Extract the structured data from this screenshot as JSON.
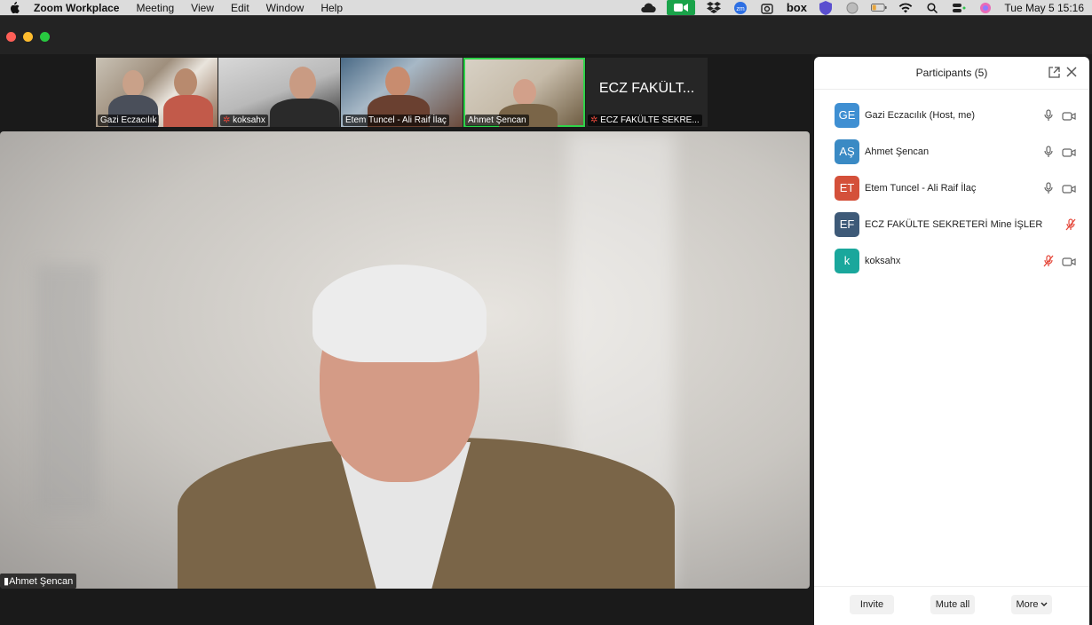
{
  "menubar": {
    "app_name": "Zoom Workplace",
    "menus": [
      "Meeting",
      "View",
      "Edit",
      "Window",
      "Help"
    ],
    "box_label": "box",
    "clock": "Tue May 5  15:16"
  },
  "thumbnails": [
    {
      "name": "Gazi Eczacılık",
      "muted": false
    },
    {
      "name": "koksahx",
      "muted": true
    },
    {
      "name": "Etem Tuncel - Ali Raif İlaç",
      "muted": false
    },
    {
      "name": "Ahmet Şencan",
      "muted": false,
      "active": true
    },
    {
      "name": "ECZ FAKÜLTE SEKRE...",
      "muted": true,
      "big_text": "ECZ FAKÜLT..."
    }
  ],
  "main_video": {
    "speaker_name": "Ahmet Şencan"
  },
  "participants_panel": {
    "title": "Participants (5)",
    "participants": [
      {
        "initials": "GE",
        "name": "Gazi Eczacılık (Host, me)",
        "color": "#3f8fd2",
        "muted": false,
        "video": true
      },
      {
        "initials": "AŞ",
        "name": "Ahmet Şencan",
        "color": "#3a8ac4",
        "muted": false,
        "video": true
      },
      {
        "initials": "ET",
        "name": "Etem Tuncel - Ali Raif İlaç",
        "color": "#d4503a",
        "muted": false,
        "video": true
      },
      {
        "initials": "EF",
        "name": "ECZ FAKÜLTE SEKRETERİ Mine İŞLER",
        "color": "#3e5a78",
        "muted": true,
        "video": false
      },
      {
        "initials": "k",
        "name": "koksahx",
        "color": "#1aa79c",
        "muted": true,
        "video": true
      }
    ],
    "footer": {
      "invite": "Invite",
      "mute_all": "Mute all",
      "more": "More"
    }
  },
  "colors": {
    "active_speaker_border": "#2fd34a",
    "muted_icon": "#e5483b",
    "zoom_menubar_icon": "#1aa34a"
  }
}
